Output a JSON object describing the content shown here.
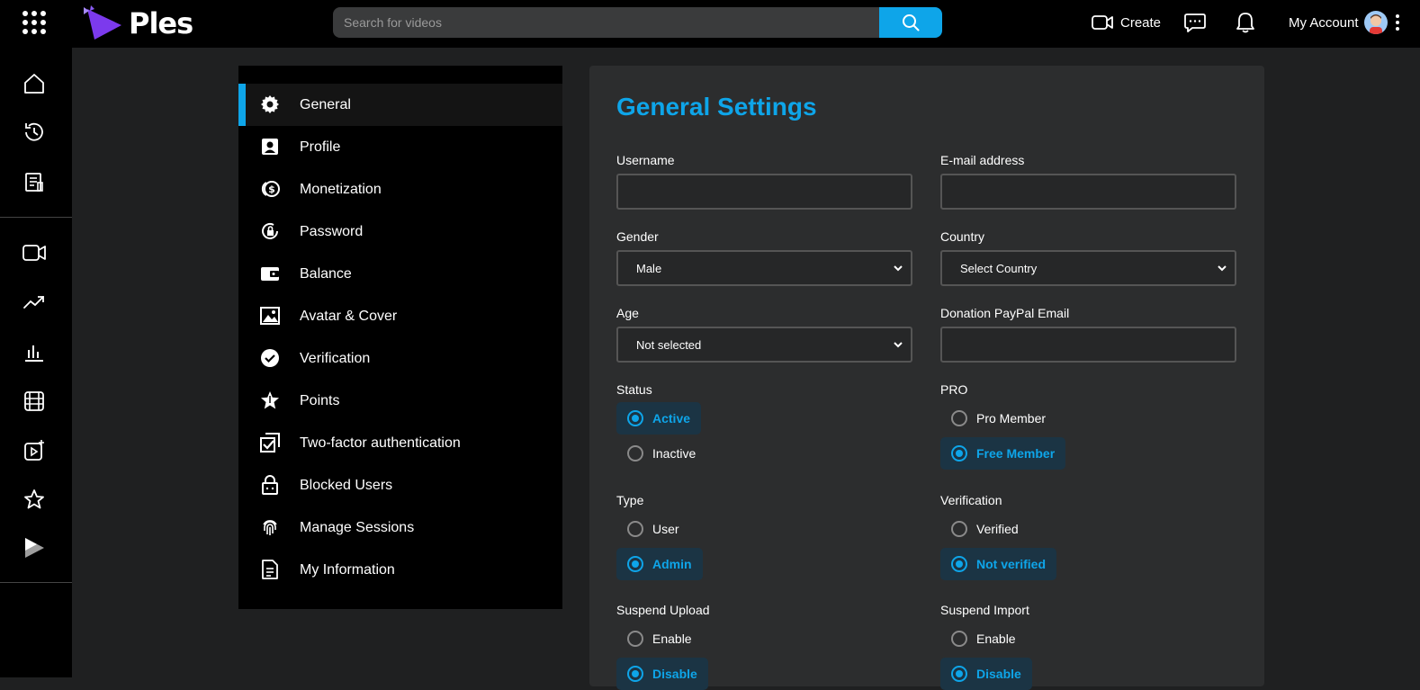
{
  "app": {
    "name": "Ples"
  },
  "header": {
    "search_placeholder": "Search for videos",
    "create_label": "Create",
    "account_label": "My Account"
  },
  "settings_menu": {
    "items": [
      {
        "label": "General",
        "icon": "gear-icon",
        "active": true
      },
      {
        "label": "Profile",
        "icon": "profile-icon"
      },
      {
        "label": "Monetization",
        "icon": "monetization-icon"
      },
      {
        "label": "Password",
        "icon": "password-lock-icon"
      },
      {
        "label": "Balance",
        "icon": "wallet-icon"
      },
      {
        "label": "Avatar & Cover",
        "icon": "image-icon"
      },
      {
        "label": "Verification",
        "icon": "check-circle-icon"
      },
      {
        "label": "Points",
        "icon": "star-icon"
      },
      {
        "label": "Two-factor authentication",
        "icon": "two-factor-icon"
      },
      {
        "label": "Blocked Users",
        "icon": "lock-icon"
      },
      {
        "label": "Manage Sessions",
        "icon": "fingerprint-icon"
      },
      {
        "label": "My Information",
        "icon": "document-icon"
      }
    ]
  },
  "form": {
    "title": "General Settings",
    "username": {
      "label": "Username",
      "value": ""
    },
    "email": {
      "label": "E-mail address",
      "value": ""
    },
    "gender": {
      "label": "Gender",
      "value": "Male"
    },
    "country": {
      "label": "Country",
      "value": "Select Country"
    },
    "age": {
      "label": "Age",
      "value": "Not selected"
    },
    "paypal": {
      "label": "Donation PayPal Email",
      "value": ""
    },
    "status": {
      "label": "Status",
      "options": [
        "Active",
        "Inactive"
      ],
      "selected": "Active"
    },
    "pro": {
      "label": "PRO",
      "options": [
        "Pro Member",
        "Free Member"
      ],
      "selected": "Free Member"
    },
    "type": {
      "label": "Type",
      "options": [
        "User",
        "Admin"
      ],
      "selected": "Admin"
    },
    "verification": {
      "label": "Verification",
      "options": [
        "Verified",
        "Not verified"
      ],
      "selected": "Not verified"
    },
    "suspend_upload": {
      "label": "Suspend Upload",
      "options": [
        "Enable",
        "Disable"
      ],
      "selected": "Disable"
    },
    "suspend_import": {
      "label": "Suspend Import",
      "options": [
        "Enable",
        "Disable"
      ],
      "selected": "Disable"
    }
  },
  "colors": {
    "accent": "#0ea5e9",
    "panel": "#2c2d2e",
    "background": "#1f2021"
  }
}
